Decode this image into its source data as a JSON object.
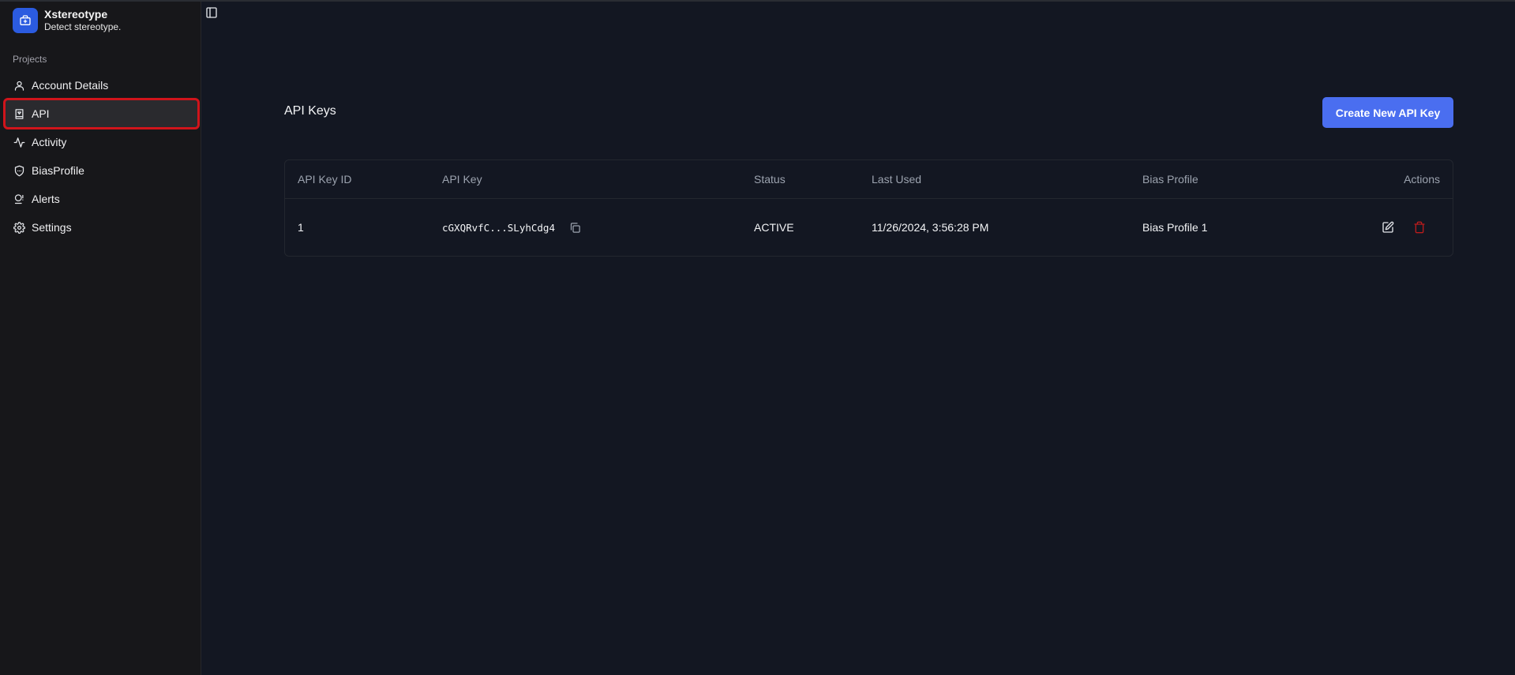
{
  "app": {
    "name": "Xstereotype",
    "tagline": "Detect stereotype."
  },
  "sidebar": {
    "section_label": "Projects",
    "items": [
      {
        "label": "Account Details",
        "icon": "user-icon",
        "active": false
      },
      {
        "label": "API",
        "icon": "api-book-icon",
        "active": true
      },
      {
        "label": "Activity",
        "icon": "activity-icon",
        "active": false
      },
      {
        "label": "BiasProfile",
        "icon": "shield-icon",
        "active": false
      },
      {
        "label": "Alerts",
        "icon": "alert-bell-icon",
        "active": false
      },
      {
        "label": "Settings",
        "icon": "gear-icon",
        "active": false
      }
    ]
  },
  "main": {
    "title": "API Keys",
    "create_button": "Create New API Key",
    "table": {
      "columns": [
        "API Key ID",
        "API Key",
        "Status",
        "Last Used",
        "Bias Profile",
        "Actions"
      ],
      "rows": [
        {
          "id": "1",
          "key": "cGXQRvfC...SLyhCdg4",
          "status": "ACTIVE",
          "last_used": "11/26/2024, 3:56:28 PM",
          "bias_profile": "Bias Profile 1"
        }
      ]
    }
  },
  "colors": {
    "accent": "#4a6ef0",
    "brand": "#2b5be0",
    "danger": "#b91c1c",
    "highlight": "#d0141b"
  }
}
